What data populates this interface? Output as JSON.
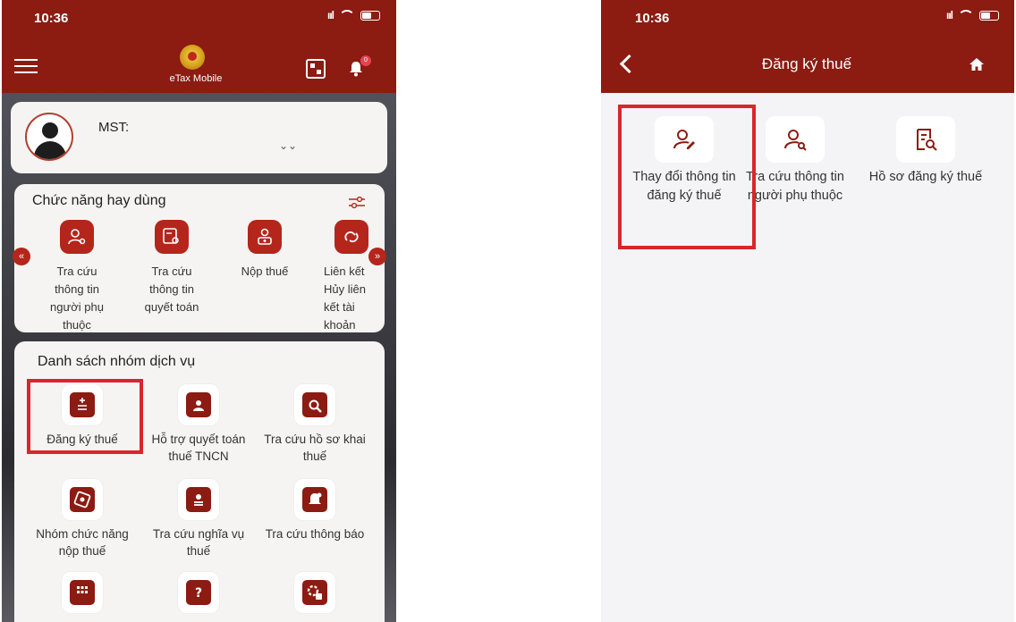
{
  "left_screen": {
    "status_time": "10:36",
    "app_title": "eTax Mobile",
    "notification_count": "0",
    "profile": {
      "mst_label": "MST:"
    },
    "quick_functions": {
      "title": "Chức năng hay dùng",
      "items": [
        {
          "label": "Tra cứu thông tin người phụ thuộc",
          "icon": "user-search-icon"
        },
        {
          "label": "Tra cứu thông tin quyết toán",
          "icon": "settlement-search-icon"
        },
        {
          "label": "Nộp thuế",
          "icon": "pay-tax-icon"
        },
        {
          "label": "Liên kết Hủy liên kết tài khoản",
          "icon": "link-icon"
        }
      ],
      "nav_prev": "«",
      "nav_next": "»"
    },
    "service_groups": {
      "title": "Danh sách nhóm dịch vụ",
      "items": [
        {
          "label": "Đăng ký thuế",
          "icon": "tax-register-icon",
          "highlighted": true
        },
        {
          "label": "Hỗ trợ quyết toán thuế TNCN",
          "icon": "document-person-icon"
        },
        {
          "label": "Tra cứu hồ sơ khai thuế",
          "icon": "file-search-icon"
        },
        {
          "label": "Nhóm chức năng nộp thuế",
          "icon": "payment-group-icon"
        },
        {
          "label": "Tra cứu nghĩa vụ thuế",
          "icon": "obligation-icon"
        },
        {
          "label": "Tra cứu thông báo",
          "icon": "notification-icon"
        },
        {
          "label": "",
          "icon": "calculator-icon"
        },
        {
          "label": "",
          "icon": "question-icon"
        },
        {
          "label": "",
          "icon": "settings-icon"
        }
      ]
    }
  },
  "right_screen": {
    "status_time": "10:36",
    "title": "Đăng ký thuế",
    "items": [
      {
        "label": "Thay đổi thông tin đăng ký thuế",
        "icon": "user-edit-icon",
        "highlighted": true
      },
      {
        "label": "Tra cứu thông tin người phụ thuộc",
        "icon": "user-search-icon"
      },
      {
        "label": "Hồ sơ đăng ký thuế",
        "icon": "document-search-icon"
      }
    ]
  },
  "colors": {
    "header": "#8c1b12",
    "accent": "#b4261b",
    "highlight": "#d9262c"
  }
}
